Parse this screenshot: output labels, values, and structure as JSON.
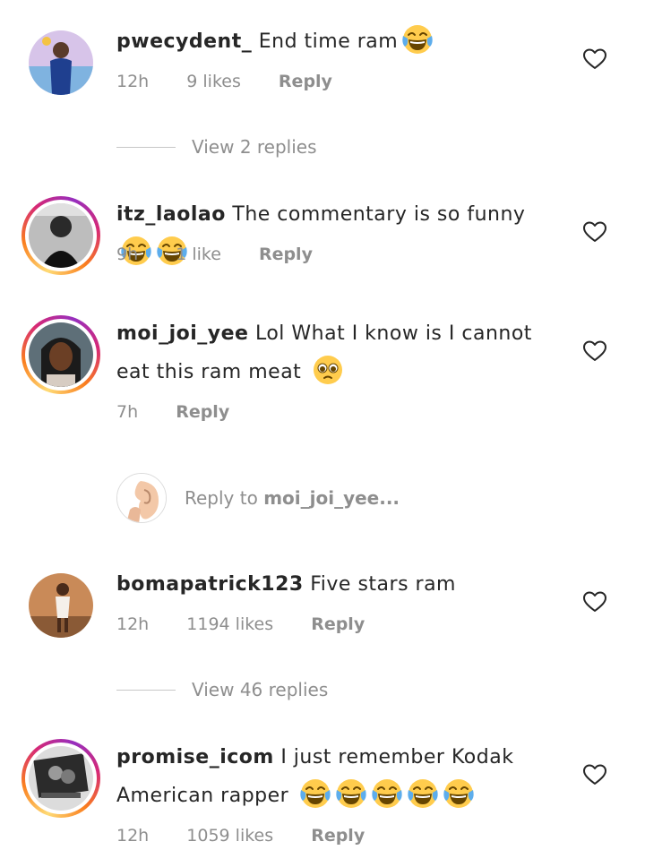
{
  "comments": [
    {
      "username": "pwecydent_",
      "text": "End time ram",
      "emojis": [
        "laugh-cry"
      ],
      "time": "12h",
      "likes": "9 likes",
      "reply": "Reply",
      "view_replies": "View 2 replies"
    },
    {
      "username": "itz_laolao",
      "text": "The commentary is so funny",
      "emojis": [
        "laugh-cry",
        "laugh-cry"
      ],
      "time": "9h",
      "likes": "1 like",
      "reply": "Reply"
    },
    {
      "username": "moi_joi_yee",
      "text": "Lol What I know is I cannot eat this ram meat",
      "emojis": [
        "pleading-face"
      ],
      "time": "7h",
      "reply": "Reply"
    },
    {
      "username": "bomapatrick123",
      "text": "Five stars ram",
      "time": "12h",
      "likes": "1194 likes",
      "reply": "Reply",
      "view_replies": "View 46 replies"
    },
    {
      "username": "promise_icom",
      "text": "I just remember Kodak American rapper",
      "emojis": [
        "laugh-cry",
        "laugh-cry",
        "laugh-cry",
        "laugh-cry",
        "laugh-cry"
      ],
      "time": "12h",
      "likes": "1059 likes",
      "reply": "Reply"
    }
  ],
  "reply_box": {
    "prefix": "Reply to",
    "target": "moi_joi_yee..."
  },
  "colors": {
    "text": "#262626",
    "muted": "#8e8e8e",
    "divider": "#c7c7c7"
  },
  "icons": [
    "heart-outline-icon",
    "laugh-cry-emoji",
    "pleading-face-emoji"
  ]
}
